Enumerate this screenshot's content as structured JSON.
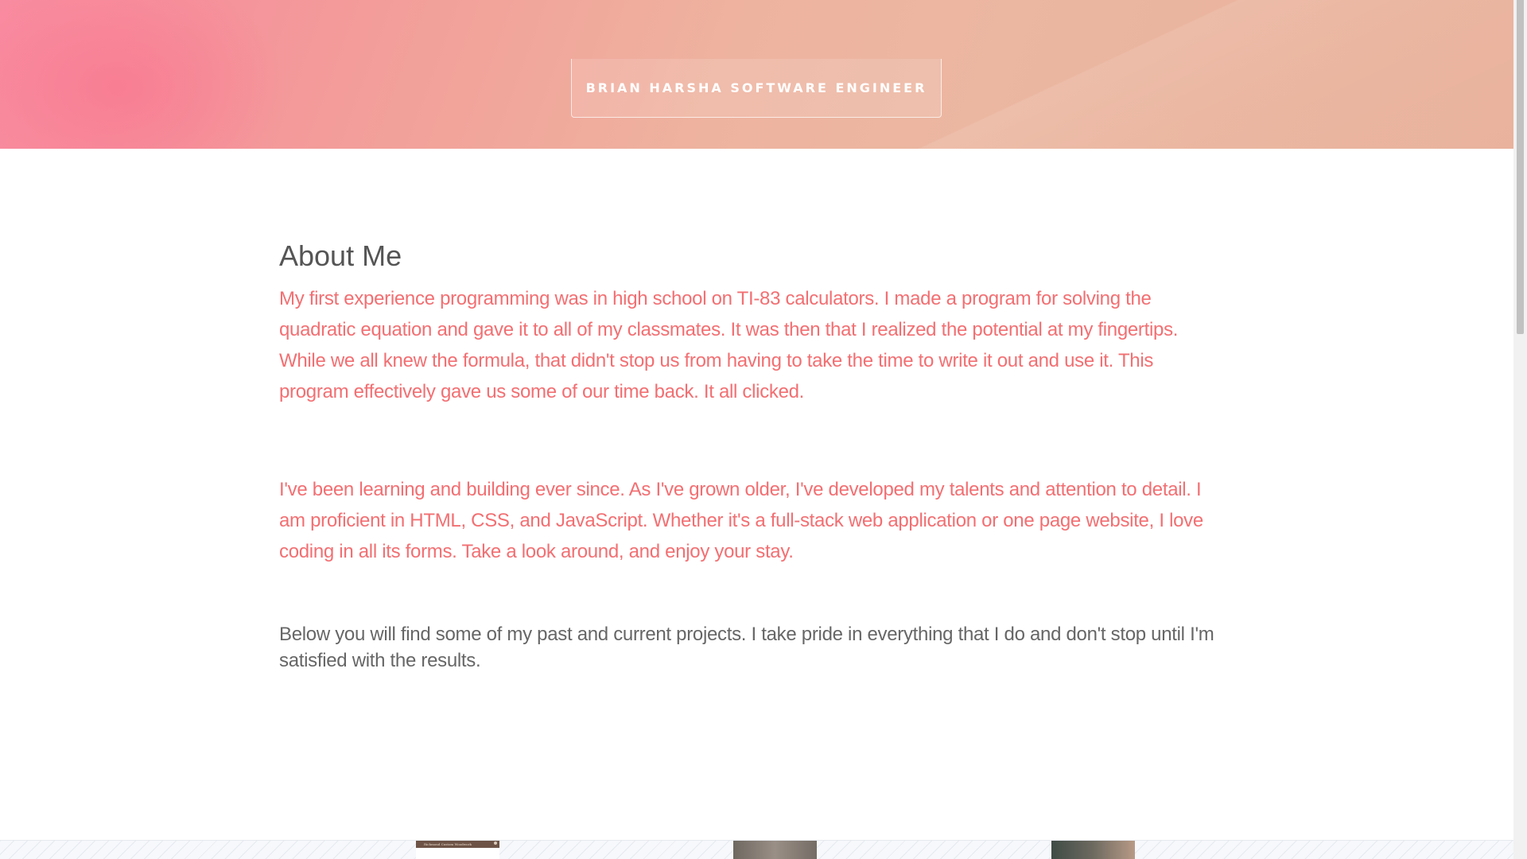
{
  "header": {
    "title": "BRIAN HARSHA SOFTWARE ENGINEER"
  },
  "about": {
    "heading": "About Me",
    "paragraphs": [
      "My first experience programming was in high school on TI-83 calculators. I made a program for solving the quadratic equation and gave it to all of my classmates. It was then that I realized the potential at my fingertips. While we all knew the formula, that didn't stop us from having to take the time to write it out and use it. This program effectively gave us some of our time back. It all clicked.",
      "I've been learning and building ever since. As I've grown older, I've developed my talents and attention to detail. I am proficient in HTML, CSS, and JavaScript. Whether it's a full-stack web application or one page website, I love coding in all its forms. Take a look around, and enjoy your stay.",
      "Below you will find some of my past and current projects. I take pride in everything that I do and don't stop until I'm satisfied with the results."
    ]
  },
  "projects": {
    "thumb_1_caption": "Richmond Custom Woodwork"
  },
  "colors": {
    "accent_text": "#f26f72",
    "heading_text": "#555555",
    "body_text": "#666666",
    "banner_start": "#f98ba0",
    "banner_end": "#e9b29c"
  }
}
